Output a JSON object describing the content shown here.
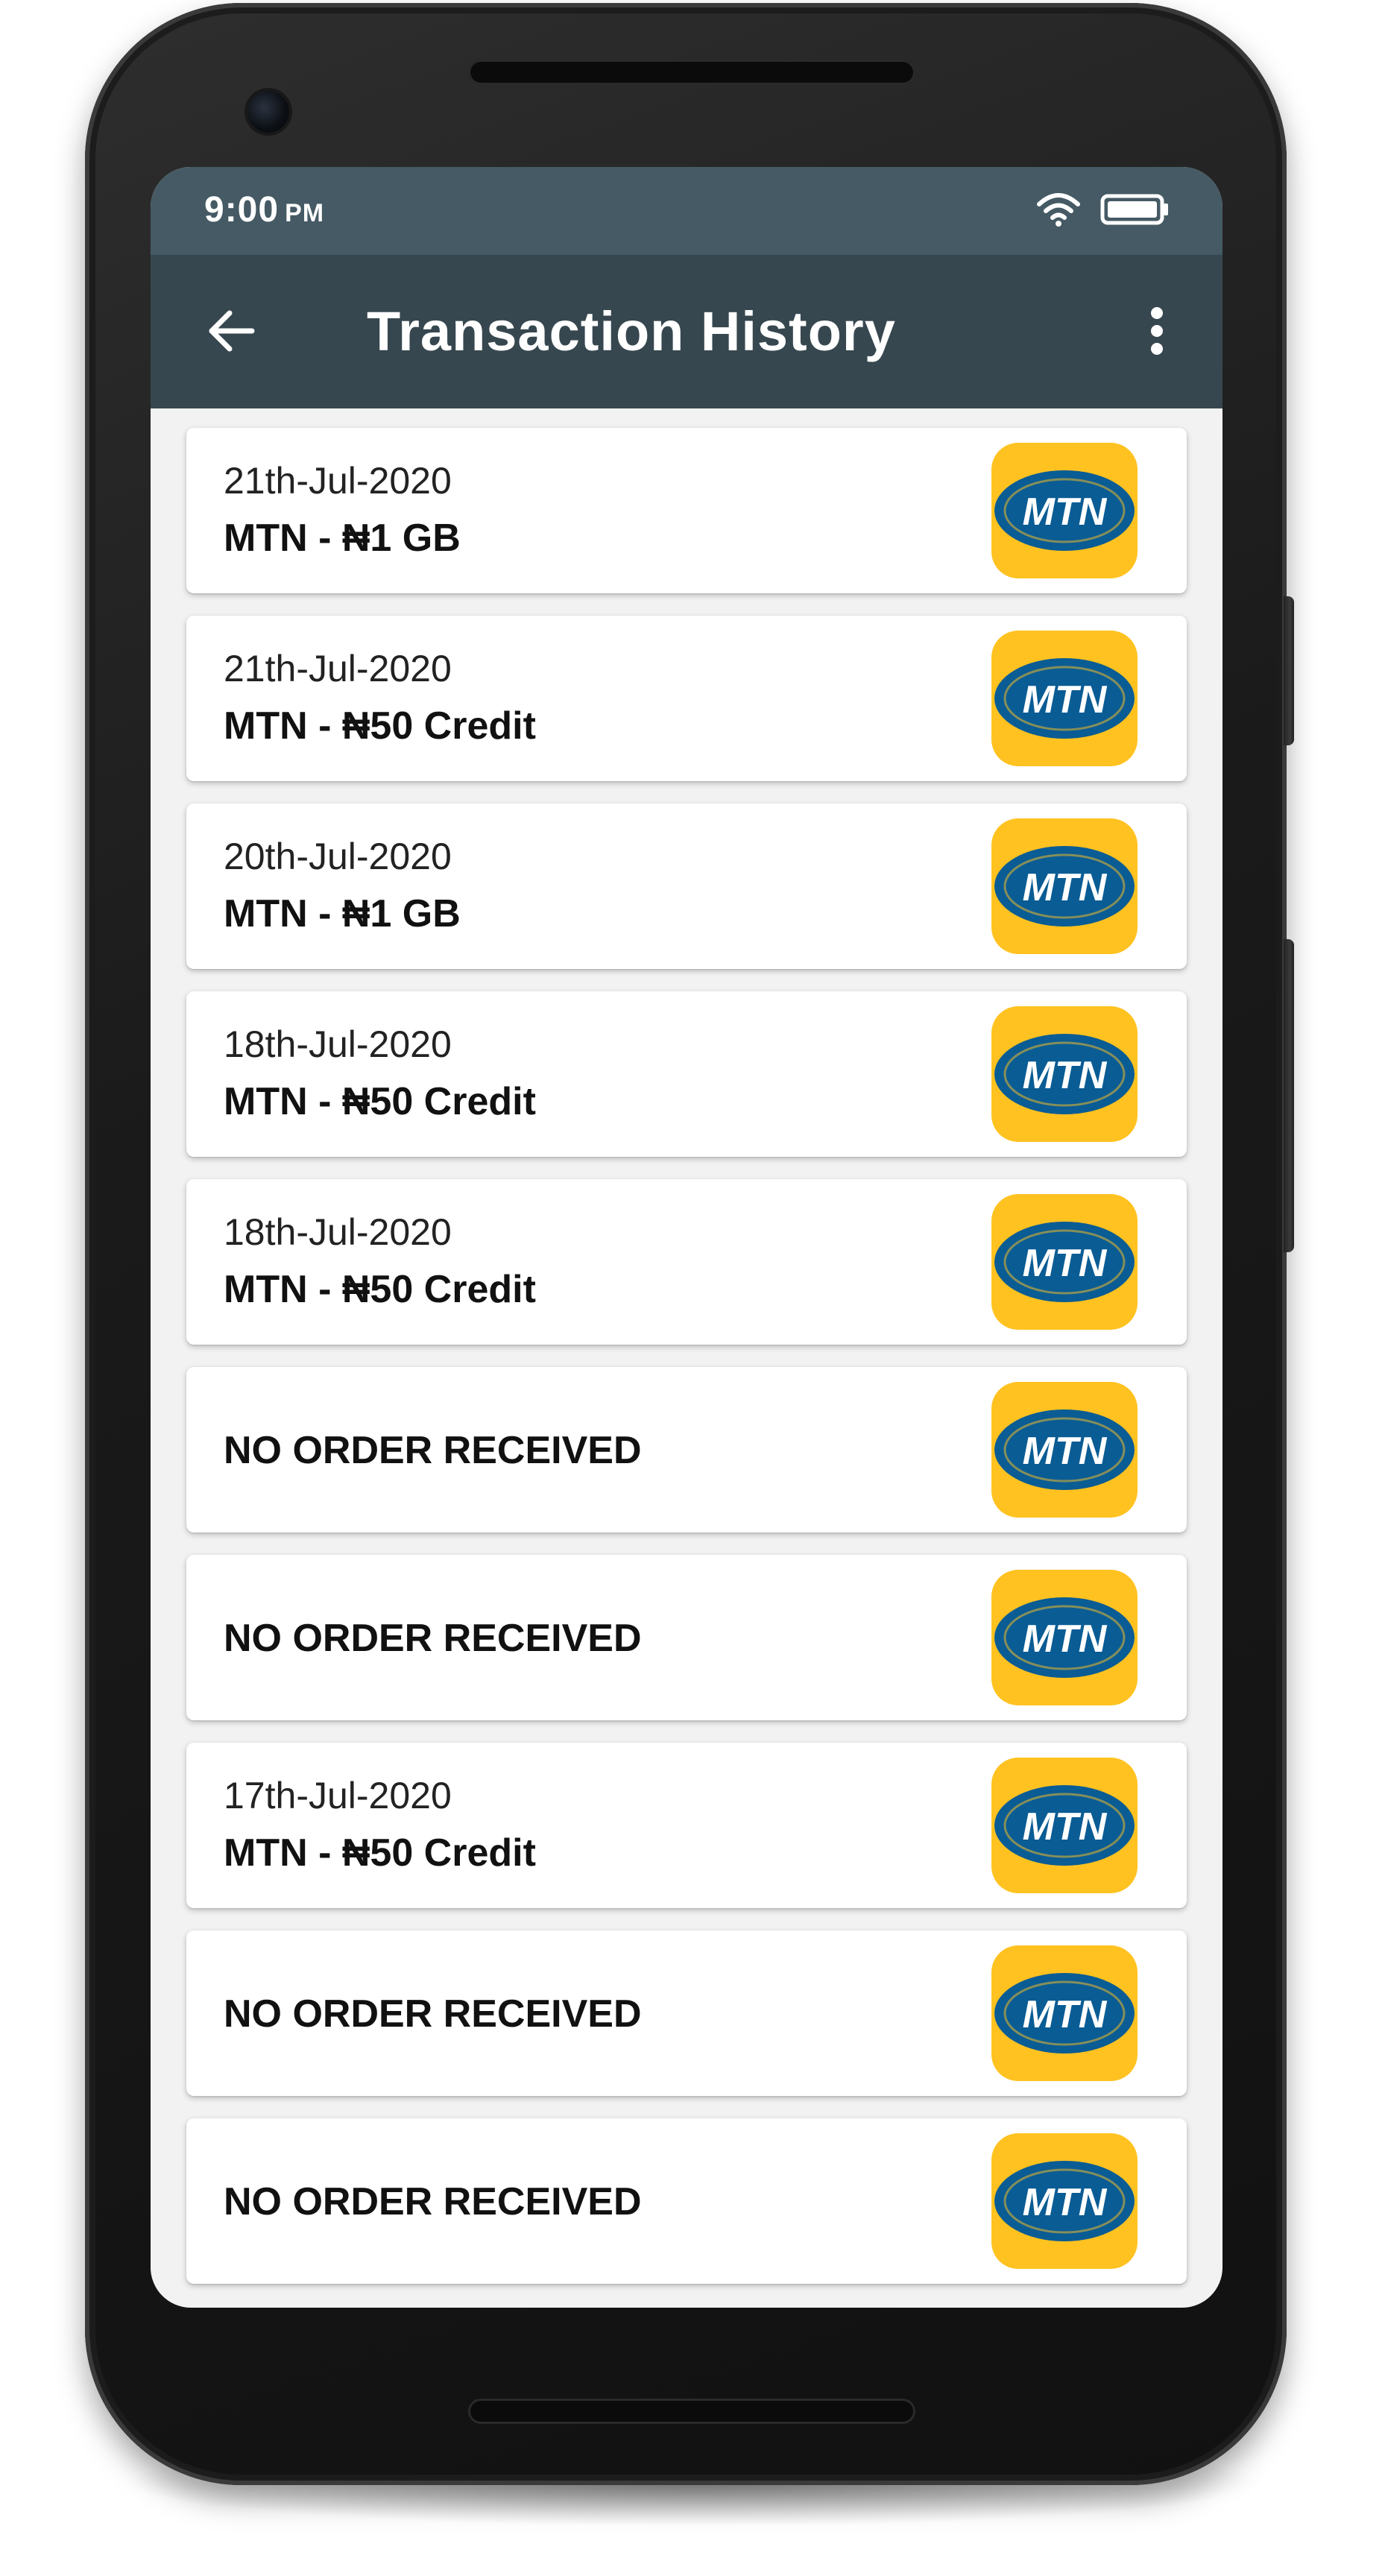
{
  "status_bar": {
    "time": "9:00",
    "ampm": "PM",
    "icons": [
      "wifi-icon",
      "battery-icon"
    ]
  },
  "app_bar": {
    "title": "Transaction History",
    "back_icon": "arrow-left-icon",
    "menu_icon": "more-vert-icon"
  },
  "colors": {
    "status_bar": "#455a64",
    "app_bar": "#37474f",
    "logo_yellow": "#ffc220",
    "logo_blue": "#0a5c94"
  },
  "transactions": [
    {
      "date": "21th-Jul-2020",
      "description": "MTN - ₦1 GB",
      "logo_text": "MTN"
    },
    {
      "date": "21th-Jul-2020",
      "description": "MTN - ₦50 Credit",
      "logo_text": "MTN"
    },
    {
      "date": "20th-Jul-2020",
      "description": "MTN - ₦1 GB",
      "logo_text": "MTN"
    },
    {
      "date": "18th-Jul-2020",
      "description": "MTN - ₦50 Credit",
      "logo_text": "MTN"
    },
    {
      "date": "18th-Jul-2020",
      "description": "MTN - ₦50 Credit",
      "logo_text": "MTN"
    },
    {
      "date": "",
      "description": "",
      "empty_text": "NO ORDER RECEIVED",
      "logo_text": "MTN"
    },
    {
      "date": "",
      "description": "",
      "empty_text": "NO ORDER RECEIVED",
      "logo_text": "MTN"
    },
    {
      "date": "17th-Jul-2020",
      "description": "MTN - ₦50 Credit",
      "logo_text": "MTN"
    },
    {
      "date": "",
      "description": "",
      "empty_text": "NO ORDER RECEIVED",
      "logo_text": "MTN"
    },
    {
      "date": "",
      "description": "",
      "empty_text": "NO ORDER RECEIVED",
      "logo_text": "MTN"
    }
  ]
}
